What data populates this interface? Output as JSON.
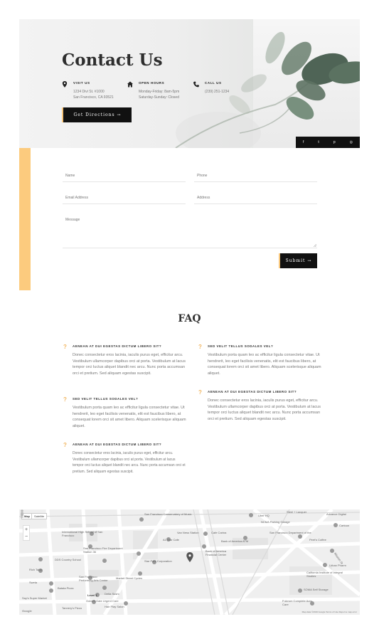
{
  "hero": {
    "title": "Contact Us",
    "visit": {
      "label": "VISIT US",
      "line1": "1234 Divi St. #1000",
      "line2": "San Francisco, CA 93521"
    },
    "hours": {
      "label": "OPEN HOURS",
      "line1": "Monday-Friday: 8am-5pm",
      "line2": "Saturday-Sunday: Closed"
    },
    "call": {
      "label": "CALL US",
      "line1": "(239) 251-1234"
    },
    "directions_button": "Get Directions →",
    "social": [
      "f",
      "t",
      "p",
      "◎"
    ]
  },
  "form": {
    "name_placeholder": "Name",
    "phone_placeholder": "Phone",
    "email_placeholder": "Email Address",
    "address_placeholder": "Address",
    "message_placeholder": "Message",
    "submit_label": "Submit →"
  },
  "faq": {
    "title": "FAQ",
    "left": [
      {
        "q": "AENEAN AT DUI EGESTAS DICTUM LIBERO SIT?",
        "a": "Donec consectetur eros lacinia, iaculis purus eget, efficitur arcu. Vestibulum ullamcorper dapibus orci at porta. Vestibulum at lacus tempor orci luctus aliquet blandit nec arcu. Nunc porta accumsan orci et pretium. Sed aliquam egestas suscipit."
      },
      {
        "q": "SED VELIT TELLUS SODALES VEL?",
        "a": "Vestibulum porta quam leo ac efficitur ligula consectetur vitae. Ut hendrerit, leo eget facilisis venenatis, elit est faucibus libero, at consequat lorem orci sit amet libero. Aliquam scelerisque aliquam aliquet."
      },
      {
        "q": "AENEAN AT DUI EGESTAS DICTUM LIBERO SIT?",
        "a": "Donec consectetur eros lacinia, iaculis purus eget, efficitur arcu. Vestibulum ullamcorper dapibus orci at porta. Vestibulum at lacus tempor orci luctus aliquet blandit nec arcu. Nunc porta accumsan orci et pretium. Sed aliquam egestas suscipit."
      }
    ],
    "right": [
      {
        "q": "SED VELIT TELLUS SODALES VEL?",
        "a": "Vestibulum porta quam leo ac efficitur ligula consectetur vitae. Ut hendrerit, leo eget facilisis venenatis, elit est faucibus libero, at consequat lorem orci sit amet libero. Aliquam scelerisque aliquam aliquet."
      },
      {
        "q": "AENEAN AT DUI EGESTAS DICTUM LIBERO SIT?",
        "a": "Donec consectetur eros lacinia, iaculis purus eget, efficitur arcu. Vestibulum ullamcorper dapibus orci at porta. Vestibulum at lacus tempor orci luctus aliquet blandit nec arcu. Nunc porta accumsan orci et pretium. Sed aliquam egestas suscipit."
      }
    ]
  },
  "map": {
    "map_button": "Map",
    "satellite_button": "Satellite",
    "labels": {
      "sfcm": "San Francisco Conservatory of Music",
      "uber": "Uber HQ",
      "steel": "Steel + Lacquer",
      "adv": "Advance Digital",
      "cartoon": "Cartoon",
      "ihs": "International High School of San Francisco",
      "vanness": "Van Ness Station",
      "ncma": "NCMA Parking Garage",
      "sfdep": "San Francisco Department of the",
      "boa": "Bank of America ATM",
      "cafecarina": "Cafe Carina",
      "fire": "San Francisco Fire Department Station 36",
      "a1": "A1 Star Cafe",
      "peets": "Peet's Coffee",
      "fdc": "Bank of America Financial Center",
      "mission": "Mission St",
      "stpark": "Star Park Corporation",
      "citizens": "DDS Country School",
      "urban": "Urban Pharm",
      "richtable": "Rich Table",
      "sfcpa": "San Francisco Performing Arts Center",
      "mbd": "Market Street Cycles",
      "ciis": "California Institute of Integral Studies",
      "sweta": "Sweta",
      "batatapizza": "Batata Pizza",
      "level": "Level 1",
      "pelt": "Delta Sushi",
      "sodastorage": "SOMA Self Storage",
      "fdn": "Fulcrum Complete Auto Care",
      "gga": "Golden Gate Urgent Care",
      "sayssuper": "Say's Super Market",
      "hayssalon": "Hair Play Salon",
      "wilkin": "Tannery's Pizza",
      "googlelogo": "Google",
      "attribution": "Map data ©2019 Google   Terms of Use   Report a map error"
    },
    "colors": {
      "marker": "#555555",
      "road": "#ffffff",
      "land": "#f1f1f1"
    }
  }
}
